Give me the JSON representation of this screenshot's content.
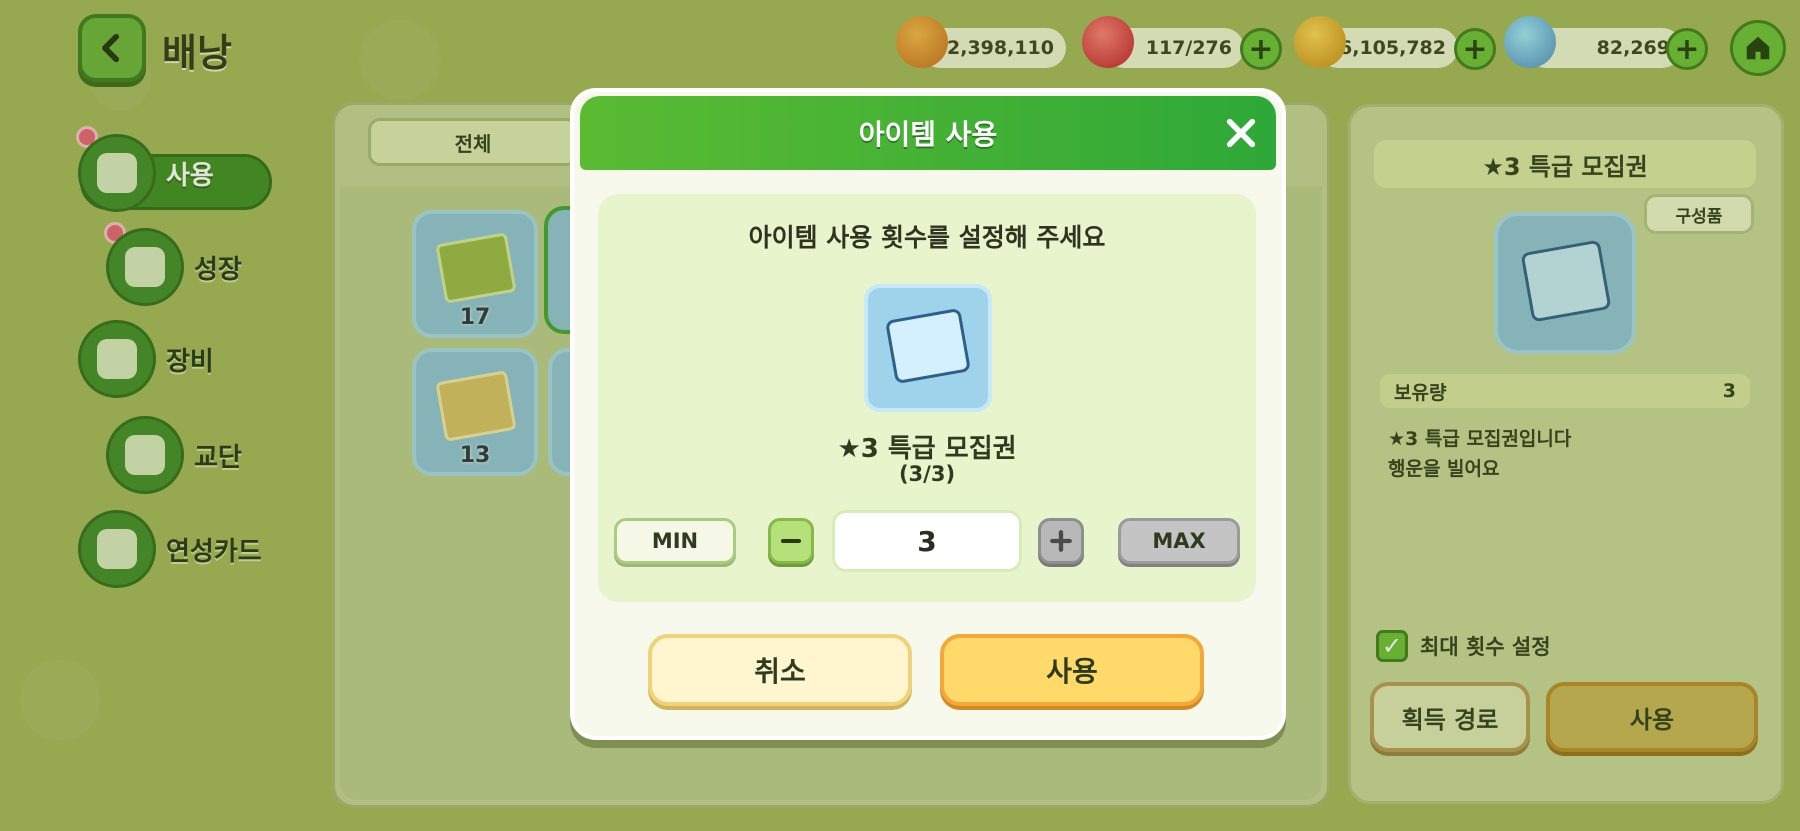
{
  "page": {
    "title": "배낭"
  },
  "currencies": [
    {
      "name": "cookie-currency",
      "value": "2,398,110",
      "color": "#e08a2c"
    },
    {
      "name": "jelly-currency",
      "value": "117/276",
      "color": "#d8303a"
    },
    {
      "name": "coin-currency",
      "value": "6,105,782",
      "color": "#e3a72a"
    },
    {
      "name": "leaf-currency",
      "value": "82,269",
      "color": "#6bc0d8"
    }
  ],
  "sidebar": {
    "items": [
      {
        "label": "사용",
        "icon": "chest-icon",
        "active": true
      },
      {
        "label": "성장",
        "icon": "potion-icon"
      },
      {
        "label": "장비",
        "icon": "armor-icon"
      },
      {
        "label": "교단",
        "icon": "castle-icon"
      },
      {
        "label": "연성카드",
        "icon": "cards-icon"
      }
    ]
  },
  "inventory": {
    "filter_label": "전체",
    "slots": [
      {
        "qty": "17",
        "ticket_color": "#9bb84a"
      },
      {
        "qty": "13",
        "ticket_color": "#d8c06a"
      }
    ]
  },
  "detail": {
    "title": "★3 특급 모집권",
    "components_label": "구성품",
    "holding_label": "보유량",
    "holding_value": "3",
    "desc_line1": "★3 특급 모집권입니다",
    "desc_line2": "행운을 빌어요",
    "max_check_label": "최대 횟수 설정",
    "obtain_label": "획득 경로",
    "use_label": "사용"
  },
  "modal": {
    "title": "아이템 사용",
    "prompt": "아이템 사용 횟수를 설정해 주세요",
    "item_name": "★3 특급 모집권",
    "item_count": "(3/3)",
    "min_label": "MIN",
    "max_label": "MAX",
    "quantity": "3",
    "cancel_label": "취소",
    "confirm_label": "사용"
  }
}
